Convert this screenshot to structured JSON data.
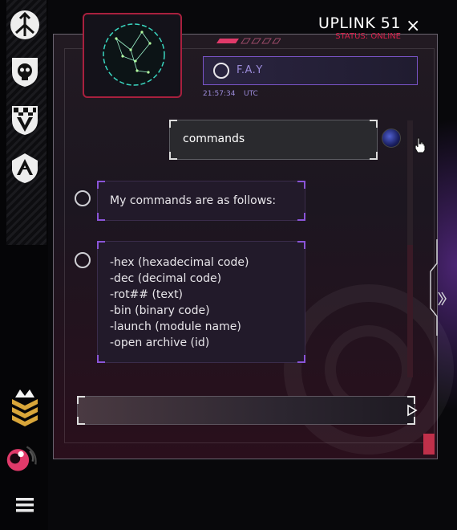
{
  "window": {
    "title": "UPLINK 51",
    "status": "STATUS: ONLINE",
    "close_icon": "×"
  },
  "contact": {
    "name": "F.A.Y",
    "time": "21:57:34",
    "timezone": "UTC"
  },
  "messages": [
    {
      "from": "user",
      "text": "commands"
    },
    {
      "from": "bot",
      "text": "My commands are as follows:"
    },
    {
      "from": "bot",
      "lines": [
        "-hex (hexadecimal code)",
        "-dec (decimal code)",
        "-rot## (text)",
        "-bin (binary code)",
        "-launch (module name)",
        "-open archive (id)"
      ]
    }
  ],
  "input": {
    "value": "",
    "placeholder": ""
  },
  "sidebar": {
    "icons": [
      "tripod-emblem-icon",
      "skull-shield-icon",
      "checkered-v-shield-icon",
      "wing-shield-icon",
      "rank-chevrons-icon",
      "planet-signal-icon",
      "menu-icon"
    ]
  },
  "colors": {
    "accent": "#d8204a",
    "violet": "#8a54d8",
    "panel": "#1c1620"
  }
}
